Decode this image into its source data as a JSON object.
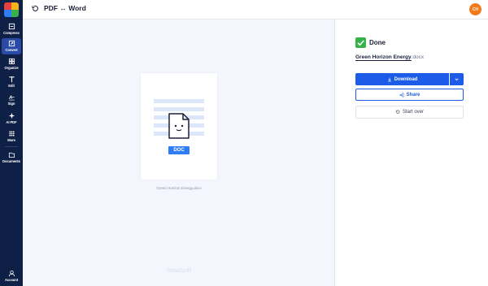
{
  "sidebar": {
    "items": [
      {
        "label": "Compress",
        "icon": "compress-icon",
        "active": false
      },
      {
        "label": "Convert",
        "icon": "convert-icon",
        "active": true
      },
      {
        "label": "Organize",
        "icon": "organize-icon",
        "active": false
      },
      {
        "label": "Edit",
        "icon": "edit-text-icon",
        "active": false
      },
      {
        "label": "Sign",
        "icon": "sign-icon",
        "active": false
      },
      {
        "label": "AI PDF",
        "icon": "ai-sparkle-icon",
        "active": false
      },
      {
        "label": "More",
        "icon": "grid-icon",
        "active": false
      },
      {
        "label": "Documents",
        "icon": "folder-icon",
        "active": false
      }
    ],
    "account_label": "Account"
  },
  "header": {
    "title": "PDF ↔ Word",
    "avatar_initials": "CH"
  },
  "preview": {
    "badge": "DOC",
    "file_caption": "Green Horizon Energy.docx",
    "watermark": "Smallpdf"
  },
  "panel": {
    "status": "Done",
    "file_base": "Green Horizon Energy",
    "file_ext": ".docx",
    "download_label": "Download",
    "share_label": "Share",
    "start_over_label": "Start over"
  },
  "colors": {
    "sidebar_bg": "#0f2046",
    "accent": "#1c5ce8",
    "success": "#35b34a",
    "avatar": "#f27a1a"
  }
}
